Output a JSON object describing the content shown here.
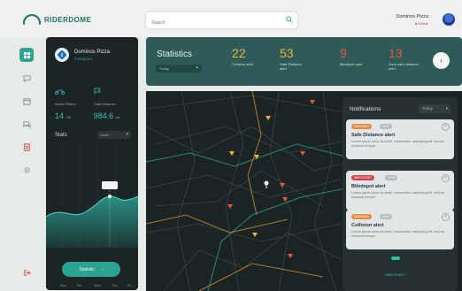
{
  "app": {
    "brand": "RIDERDOME"
  },
  "search": {
    "placeholder": "Search"
  },
  "user": {
    "name": "Dominos Pizza",
    "status": "● Delete"
  },
  "sidebar": {
    "items": [
      {
        "icon": "dashboard-icon",
        "active": true
      },
      {
        "icon": "chat-icon",
        "active": false
      },
      {
        "icon": "calendar-icon",
        "active": false
      },
      {
        "icon": "message-icon",
        "active": false
      },
      {
        "icon": "report-icon",
        "active": false
      },
      {
        "icon": "gear-icon",
        "active": false
      },
      {
        "icon": "logout-icon",
        "active": false
      }
    ]
  },
  "profile": {
    "name": "Dominos Pizza",
    "subtitle": "Instagram",
    "active_riders_label": "Active Riders",
    "active_riders_value": "14",
    "active_riders_unit": "/25",
    "total_distance_label": "Total Distance",
    "total_distance_value": "984.6",
    "total_distance_unit": "km",
    "stats_title": "Stats",
    "stats_filter": "Week",
    "cta_label": "Statistic",
    "chart_x": [
      "Mon",
      "Tue",
      "Wed",
      "Thu",
      "Fri"
    ]
  },
  "statistics": {
    "title": "Statistics",
    "filter": "Today",
    "items": [
      {
        "value": "22",
        "label": "Collision alert",
        "color": "#f0b43a"
      },
      {
        "value": "53",
        "label": "Safe Distance alert",
        "color": "#f0b43a"
      },
      {
        "value": "9",
        "label": "Blindspot alert",
        "color": "#e8573f"
      },
      {
        "value": "13",
        "label": "Sock safe distance alert",
        "color": "#e8573f"
      }
    ]
  },
  "notifications": {
    "title": "Notifications",
    "filter": "Today",
    "view_more": "View more ›",
    "items": [
      {
        "badge": "WARNING",
        "badge_color": "#e8903f",
        "badge2": "NEW",
        "title": "Safe Distance alert",
        "desc": "Lorem ipsum dolor sit amet, consectetur adipiscing elit. sed do eiusmod tempor"
      },
      {
        "badge": "IMPORTANT",
        "badge_color": "#d9424a",
        "badge2": "NEW",
        "title": "Blindspot alert",
        "desc": "Lorem ipsum dolor sit amet, consectetur adipiscing elit. sed do eiusmod tempor"
      },
      {
        "badge": "WARNING",
        "badge_color": "#e8903f",
        "badge2": "NEW",
        "title": "Collision alert",
        "desc": "Lorem ipsum dolor sit amet, consectetur adipiscing elit. sed do eiusmod tempor"
      }
    ]
  }
}
